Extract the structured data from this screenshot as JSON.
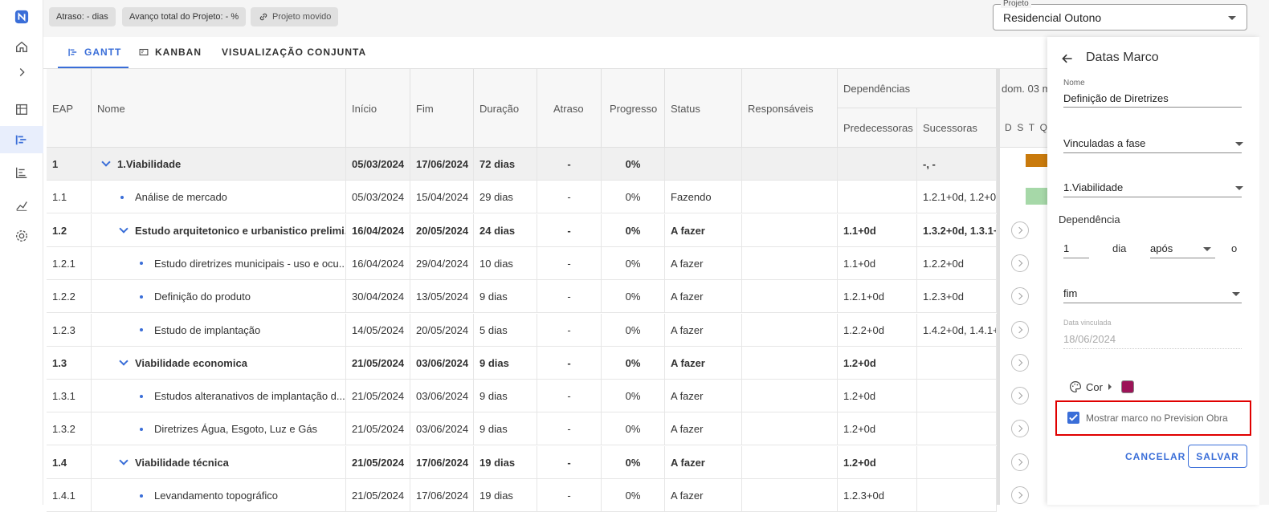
{
  "topbar": {
    "chips": [
      "Atraso: - dias",
      "Avanço total do Projeto: - %",
      "Projeto movido"
    ],
    "project_label": "Projeto",
    "project_value": "Residencial Outono"
  },
  "tabs": [
    "GANTT",
    "KANBAN",
    "VISUALIZAÇÃO CONJUNTA"
  ],
  "table": {
    "headers": {
      "eap": "EAP",
      "nome": "Nome",
      "inicio": "Início",
      "fim": "Fim",
      "duracao": "Duração",
      "atraso": "Atraso",
      "progresso": "Progresso",
      "status": "Status",
      "responsaveis": "Responsáveis",
      "dependencias": "Dependências",
      "predecessoras": "Predecessoras",
      "sucessoras": "Sucessoras"
    },
    "gantt_header": {
      "date": "dom. 03 m",
      "days": "D  S  T  Q"
    },
    "rows": [
      {
        "eap": "1",
        "nome": "1.Viabilidade",
        "inicio": "05/03/2024",
        "fim": "17/06/2024",
        "duracao": "72 dias",
        "atraso": "-",
        "progresso": "0%",
        "status": "",
        "pred": "",
        "suc": "-, -"
      },
      {
        "eap": "1.1",
        "nome": "Análise de mercado",
        "inicio": "05/03/2024",
        "fim": "15/04/2024",
        "duracao": "29 dias",
        "atraso": "-",
        "progresso": "0%",
        "status": "Fazendo",
        "pred": "",
        "suc": "1.2.1+0d, 1.2+0d"
      },
      {
        "eap": "1.2",
        "nome": "Estudo arquitetonico e urbanistico prelimi...",
        "inicio": "16/04/2024",
        "fim": "20/05/2024",
        "duracao": "24 dias",
        "atraso": "-",
        "progresso": "0%",
        "status": "A fazer",
        "pred": "1.1+0d",
        "suc": "1.3.2+0d, 1.3.1+"
      },
      {
        "eap": "1.2.1",
        "nome": "Estudo diretrizes municipais - uso e ocu...",
        "inicio": "16/04/2024",
        "fim": "29/04/2024",
        "duracao": "10 dias",
        "atraso": "-",
        "progresso": "0%",
        "status": "A fazer",
        "pred": "1.1+0d",
        "suc": "1.2.2+0d"
      },
      {
        "eap": "1.2.2",
        "nome": "Definição do produto",
        "inicio": "30/04/2024",
        "fim": "13/05/2024",
        "duracao": "9 dias",
        "atraso": "-",
        "progresso": "0%",
        "status": "A fazer",
        "pred": "1.2.1+0d",
        "suc": "1.2.3+0d"
      },
      {
        "eap": "1.2.3",
        "nome": "Estudo de implantação",
        "inicio": "14/05/2024",
        "fim": "20/05/2024",
        "duracao": "5 dias",
        "atraso": "-",
        "progresso": "0%",
        "status": "A fazer",
        "pred": "1.2.2+0d",
        "suc": "1.4.2+0d, 1.4.1+0"
      },
      {
        "eap": "1.3",
        "nome": "Viabilidade economica",
        "inicio": "21/05/2024",
        "fim": "03/06/2024",
        "duracao": "9 dias",
        "atraso": "-",
        "progresso": "0%",
        "status": "A fazer",
        "pred": "1.2+0d",
        "suc": ""
      },
      {
        "eap": "1.3.1",
        "nome": "Estudos alteranativos de implantação d...",
        "inicio": "21/05/2024",
        "fim": "03/06/2024",
        "duracao": "9 dias",
        "atraso": "-",
        "progresso": "0%",
        "status": "A fazer",
        "pred": "1.2+0d",
        "suc": ""
      },
      {
        "eap": "1.3.2",
        "nome": "Diretrizes Água, Esgoto, Luz e Gás",
        "inicio": "21/05/2024",
        "fim": "03/06/2024",
        "duracao": "9 dias",
        "atraso": "-",
        "progresso": "0%",
        "status": "A fazer",
        "pred": "1.2+0d",
        "suc": ""
      },
      {
        "eap": "1.4",
        "nome": "Viabilidade técnica",
        "inicio": "21/05/2024",
        "fim": "17/06/2024",
        "duracao": "19 dias",
        "atraso": "-",
        "progresso": "0%",
        "status": "A fazer",
        "pred": "1.2+0d",
        "suc": ""
      },
      {
        "eap": "1.4.1",
        "nome": "Levandamento topográfico",
        "inicio": "21/05/2024",
        "fim": "17/06/2024",
        "duracao": "19 dias",
        "atraso": "-",
        "progresso": "0%",
        "status": "A fazer",
        "pred": "1.2.3+0d",
        "suc": ""
      }
    ]
  },
  "panel": {
    "title": "Datas Marco",
    "nome_label": "Nome",
    "nome_value": "Definição de Diretrizes",
    "vinculo_value": "Vinculadas a fase",
    "fase_value": "1.Viabilidade",
    "dependencia_label": "Dependência",
    "dep_number": "1",
    "dep_unit": "dia",
    "dep_relation": "após",
    "dep_o": "o",
    "dep_ref": "fim",
    "data_vinculada_label": "Data vinculada",
    "data_vinculada_value": "18/06/2024",
    "cor_label": "Cor",
    "cor_color": "#9c1458",
    "checkbox_label": "Mostrar marco no Prevision Obra",
    "cancel": "CANCELAR",
    "save": "SALVAR"
  },
  "colors": {
    "accent": "#3a6ed8",
    "bar_orange": "#c97a0c",
    "bar_green": "#a6d8a8",
    "highlight": "#e00000"
  }
}
